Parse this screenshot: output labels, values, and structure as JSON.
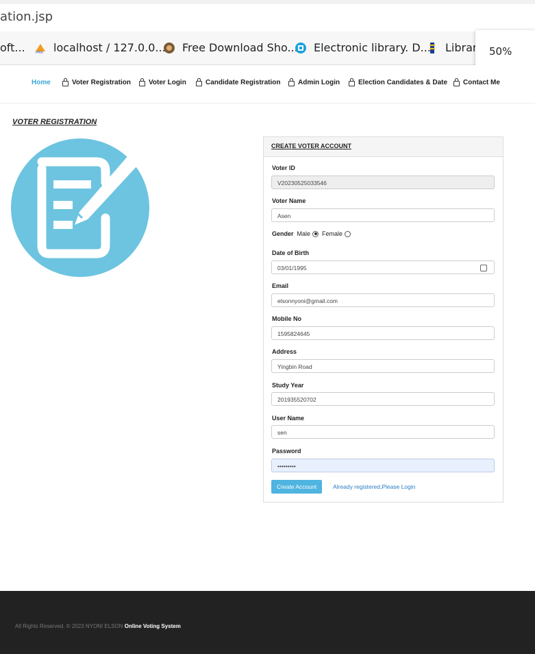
{
  "browser": {
    "address_text": "ation.jsp",
    "bookmarks": [
      {
        "label": "oft...",
        "icon": "generic"
      },
      {
        "label": "localhost / 127.0.0....",
        "icon": "phpmyadmin-icon"
      },
      {
        "label": "Free Download Sho...",
        "icon": "download-site-icon"
      },
      {
        "label": "Electronic library. D...",
        "icon": "library-icon"
      },
      {
        "label": "Library",
        "icon": "library-book-icon"
      }
    ],
    "zoom_popup": "50%"
  },
  "nav": {
    "items": [
      {
        "label": "Home",
        "active": true
      },
      {
        "label": "Voter Registration"
      },
      {
        "label": "Voter Login"
      },
      {
        "label": "Candidate Registration"
      },
      {
        "label": "Admin Login"
      },
      {
        "label": "Election Candidates & Date"
      },
      {
        "label": "Contact Me"
      }
    ]
  },
  "page": {
    "section_title": "VOTER REGISTRATION"
  },
  "form": {
    "heading": "CREATE VOTER ACCOUNT",
    "voter_id_label": "Voter ID",
    "voter_id_value": "V20230525033546",
    "voter_name_label": "Voter Name",
    "voter_name_value": "Asen",
    "gender_label": "Gender",
    "gender_male": "Male",
    "gender_female": "Female",
    "dob_label": "Date of Birth",
    "dob_value": "03/01/1995",
    "email_label": "Email",
    "email_value": "elsonnyoni@gmail.com",
    "mobile_label": "Mobile No",
    "mobile_value": "1595824645",
    "address_label": "Address",
    "address_value": "Yingbin Road",
    "study_year_label": "Study Year",
    "study_year_value": "201935520702",
    "username_label": "User Name",
    "username_value": "sen",
    "password_label": "Password",
    "password_value": "•••••••••",
    "submit_label": "Create Account",
    "login_link": "Already registered,Please Login"
  },
  "footer": {
    "text": "All Rights Reserved. © 2023 NYONI ELSON",
    "brand": "Online Voting System"
  },
  "colors": {
    "accent": "#4fb4e0",
    "icon_circle": "#6cc4e0",
    "footer_bg": "#222222"
  }
}
